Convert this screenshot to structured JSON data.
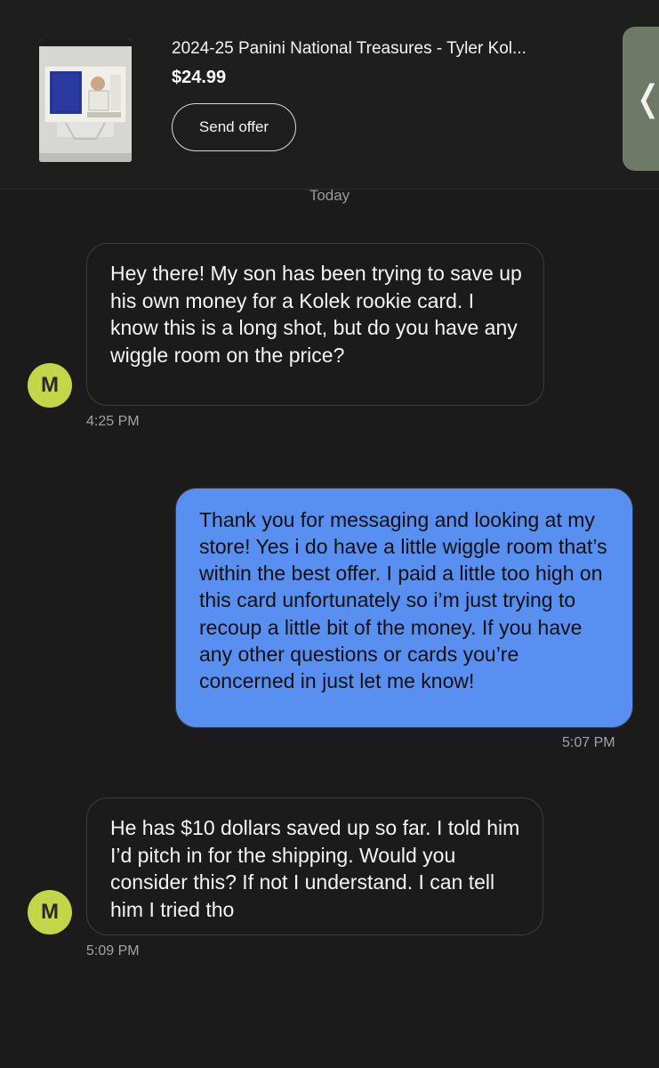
{
  "listing": {
    "title": "2024-25 Panini National Treasures - Tyler Kol...",
    "price": "$24.99",
    "send_offer_label": "Send offer",
    "side_tab_glyph": "❬"
  },
  "conversation": {
    "date_label": "Today",
    "messages": [
      {
        "sender": "buyer",
        "avatar_letter": "M",
        "text": "Hey there! My son has been trying to save up his own money for a Kolek rookie card. I know this is a long shot, but do you have any wiggle room on the price?",
        "time": "4:25 PM"
      },
      {
        "sender": "me",
        "text": "Thank you for messaging and looking at my store! Yes i do have a little wiggle room that’s within the best offer. I paid a little too high on this card unfortunately so i’m just trying to recoup a little bit of the money. If you have any other questions or cards you’re concerned in just let me know!",
        "time": "5:07 PM"
      },
      {
        "sender": "buyer",
        "avatar_letter": "M",
        "text": "He has $10 dollars saved up so far. I told him I’d pitch in for the shipping. Would you consider this? If not I understand. I can tell him I tried tho",
        "time": "5:09 PM"
      }
    ]
  },
  "colors": {
    "background": "#1b1b1b",
    "outgoing_bubble": "#5a8ff2",
    "avatar": "#c3d64a"
  }
}
